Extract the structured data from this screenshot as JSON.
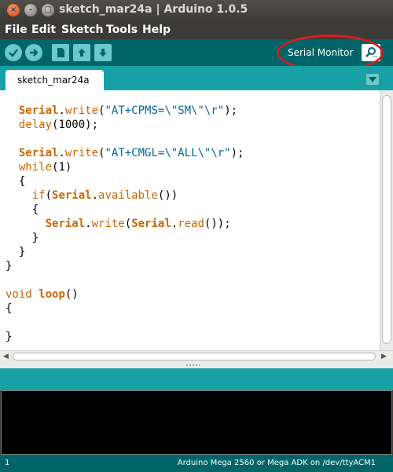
{
  "window": {
    "title": "sketch_mar24a | Arduino 1.0.5",
    "buttons": {
      "close": "×",
      "minimize": "–",
      "maximize": "□"
    }
  },
  "menu": {
    "items": [
      "File",
      "Edit",
      "Sketch",
      "Tools",
      "Help"
    ]
  },
  "toolbar": {
    "buttons": [
      {
        "name": "verify",
        "icon": "check-icon"
      },
      {
        "name": "upload",
        "icon": "arrow-right-icon"
      },
      {
        "name": "new",
        "icon": "document-icon"
      },
      {
        "name": "open",
        "icon": "arrow-up-icon"
      },
      {
        "name": "save",
        "icon": "arrow-down-icon"
      }
    ],
    "serial_monitor_label": "Serial Monitor",
    "serial_monitor_icon": "magnifier-icon"
  },
  "tabs": [
    {
      "label": "sketch_mar24a",
      "active": true
    }
  ],
  "editor": {
    "lines": [
      "  Serial.write(\"AT+CPMS=\\\"SM\\\"\\r\");",
      "  delay(1000);",
      "",
      "  Serial.write(\"AT+CMGL=\\\"ALL\\\"\\r\");",
      "  while(1)",
      "  {",
      "    if(Serial.available())",
      "    {",
      "      Serial.write(Serial.read());",
      "    }",
      "  }",
      "}",
      "",
      "void loop()",
      "{",
      "",
      "}"
    ]
  },
  "status_bar": {
    "line_number": "1",
    "board": "Arduino Mega 2560 or Mega ADK on /dev/ttyACM1"
  },
  "colors": {
    "toolbar": "#006468",
    "tabbar": "#17a1a5",
    "keyword": "#cc6600",
    "string": "#006699",
    "annotation": "#d81e1e"
  }
}
